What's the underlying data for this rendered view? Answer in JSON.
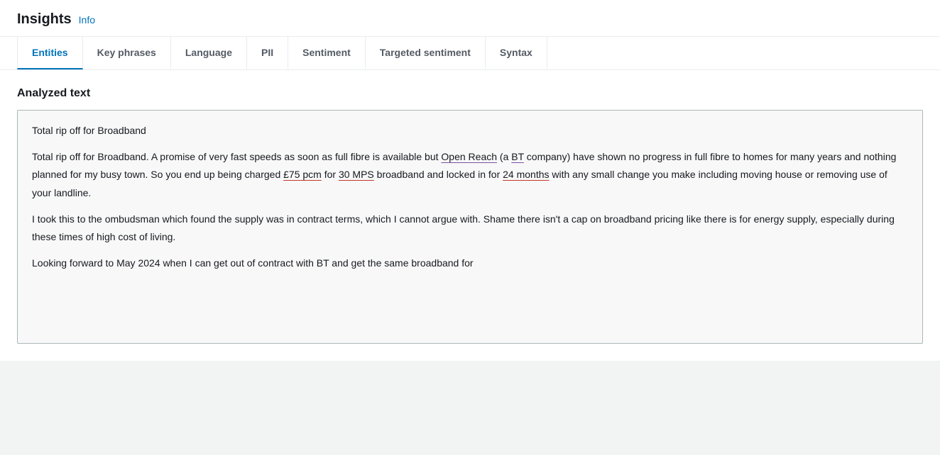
{
  "header": {
    "title": "Insights",
    "info_label": "Info"
  },
  "tabs": [
    {
      "id": "entities",
      "label": "Entities",
      "active": true
    },
    {
      "id": "key-phrases",
      "label": "Key phrases",
      "active": false
    },
    {
      "id": "language",
      "label": "Language",
      "active": false
    },
    {
      "id": "pii",
      "label": "PII",
      "active": false
    },
    {
      "id": "sentiment",
      "label": "Sentiment",
      "active": false
    },
    {
      "id": "targeted-sentiment",
      "label": "Targeted sentiment",
      "active": false
    },
    {
      "id": "syntax",
      "label": "Syntax",
      "active": false
    }
  ],
  "main": {
    "analyzed_text_label": "Analyzed text",
    "text_lines": [
      "Total rip off for Broadband",
      "Total rip off for Broadband. A promise of very fast speeds as soon as full fibre is available but Open Reach (a BT company) have shown no progress in full fibre to homes for many years and nothing planned for my busy town. So you end up being charged £75 pcm for 30 MPS broadband and locked in for 24 months with any small change you make including moving house or removing use of your landline.",
      "I took this to the ombudsman which found the supply was in contract terms, which I cannot argue with. Shame there isn't a cap on broadband pricing like there is for energy supply, especially during these times of high cost of living.",
      "Looking forward to May 2024 when I can get out of contract with BT and get the same broadband for"
    ]
  },
  "colors": {
    "active_tab": "#0073bb",
    "entity_org": "#7b4f9e",
    "entity_quantity": "#c0392b",
    "entity_date": "#c0392b"
  }
}
